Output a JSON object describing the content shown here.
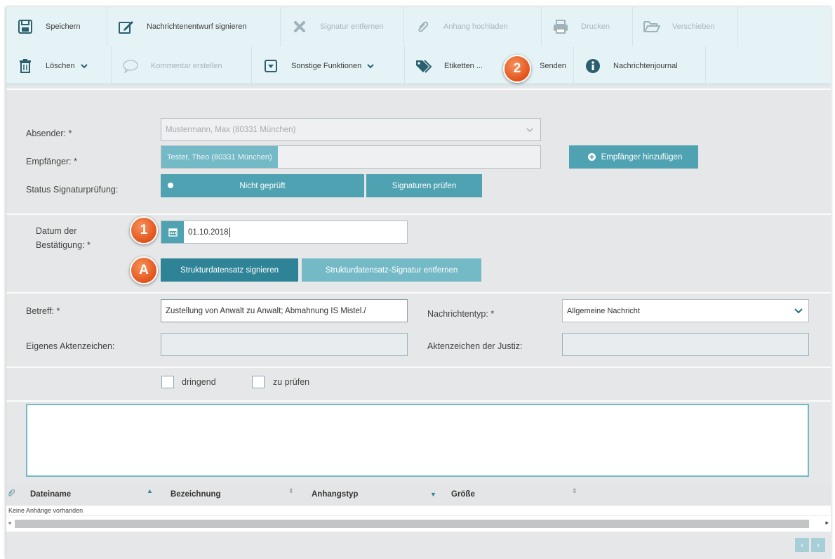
{
  "toolbar": {
    "row1": [
      {
        "label": "Speichern",
        "icon": "save-icon",
        "disabled": false
      },
      {
        "label": "Nachrichtenentwurf signieren",
        "icon": "edit-sign-icon",
        "disabled": false
      },
      {
        "label": "Signatur entfernen",
        "icon": "close-x-icon",
        "disabled": true
      },
      {
        "label": "Anhang hochladen",
        "icon": "paperclip-icon",
        "disabled": true
      },
      {
        "label": "Drucken",
        "icon": "printer-icon",
        "disabled": true
      },
      {
        "label": "Verschieben",
        "icon": "folder-open-icon",
        "disabled": true
      }
    ],
    "row2": [
      {
        "label": "Löschen",
        "icon": "trash-icon",
        "disabled": false
      },
      {
        "label": "Kommentar erstellen",
        "icon": "comment-icon",
        "disabled": true
      },
      {
        "label": "Sonstige Funktionen",
        "icon": "dropdown-box-icon",
        "disabled": false
      },
      {
        "label": "Etiketten ...",
        "icon": "tags-icon",
        "disabled": false
      },
      {
        "label": "Senden",
        "icon": "paper-plane-icon",
        "disabled": false
      },
      {
        "label": "Nachrichtenjournal",
        "icon": "info-icon",
        "disabled": false
      }
    ]
  },
  "form": {
    "absender_label": "Absender: *",
    "absender_value": "Mustermann, Max (80331 München)",
    "empfaenger_label": "Empfänger: *",
    "empfaenger_chip": "Tester, Theo (80331 München)",
    "add_recipient_label": "Empfänger hinzufügen",
    "status_label": "Status Signaturprüfung:",
    "status_value": "Nicht geprüft",
    "check_signatures_label": "Signaturen prüfen",
    "datum_label_1": "Datum der",
    "datum_label_2": "Bestätigung: *",
    "datum_value": "01.10.2018",
    "sign_struct_label": "Strukturdatensatz signieren",
    "remove_struct_sig_label": "Strukturdatensatz-Signatur entfernen",
    "betreff_label": "Betreff: *",
    "betreff_value": "Zustellung von Anwalt zu Anwalt; Abmahnung IS Mistel./",
    "nachrichtentyp_label": "Nachrichtentyp: *",
    "nachrichtentyp_value": "Allgemeine Nachricht",
    "eigenes_az_label": "Eigenes Aktenzeichen:",
    "eigenes_az_value": "",
    "justiz_az_label": "Aktenzeichen der Justiz:",
    "justiz_az_value": "",
    "dringend_label": "dringend",
    "zu_pruefen_label": "zu prüfen",
    "message_body": ""
  },
  "badges": {
    "one": "1",
    "two": "2",
    "a": "A"
  },
  "attachments": {
    "columns": [
      "Dateiname",
      "Bezeichnung",
      "Anhangstyp",
      "Größe"
    ],
    "empty_text": "Keine Anhänge vorhanden"
  },
  "pager": {
    "prev": "‹",
    "next": "›"
  },
  "colors": {
    "accent": "#4fa2b2",
    "badge": "#e8632b",
    "toolbar_bg": "#e5f3f6"
  }
}
